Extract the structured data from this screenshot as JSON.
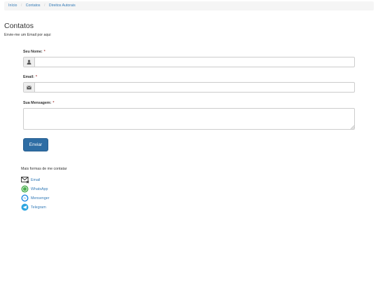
{
  "breadcrumb": {
    "items": [
      "Início",
      "Contatos",
      "Direitos Autorais"
    ]
  },
  "page": {
    "title": "Contatos",
    "subtitle": "Envie-me um Email por aqui"
  },
  "form": {
    "name_label": "Seu Nome:",
    "email_label": "Email:",
    "message_label": "Sua Mensagem:",
    "required_mark": "*",
    "name_value": "",
    "email_value": "",
    "message_value": "",
    "name_icon": "user-icon",
    "email_icon": "envelope-icon",
    "submit_label": "Enviar"
  },
  "other_contacts": {
    "title": "Mais formas de me contatar",
    "items": [
      {
        "label": "Email",
        "icon": "email-icon"
      },
      {
        "label": "WhatsApp",
        "icon": "whatsapp-icon",
        "color": "#4caf50"
      },
      {
        "label": "Mensenger",
        "icon": "messenger-icon",
        "color": "#1e88e5"
      },
      {
        "label": "Telegram",
        "icon": "telegram-icon",
        "color": "#2ca5e0"
      }
    ]
  },
  "colors": {
    "accent": "#337ab7",
    "button": "#2e6da4",
    "required": "#a94442"
  }
}
